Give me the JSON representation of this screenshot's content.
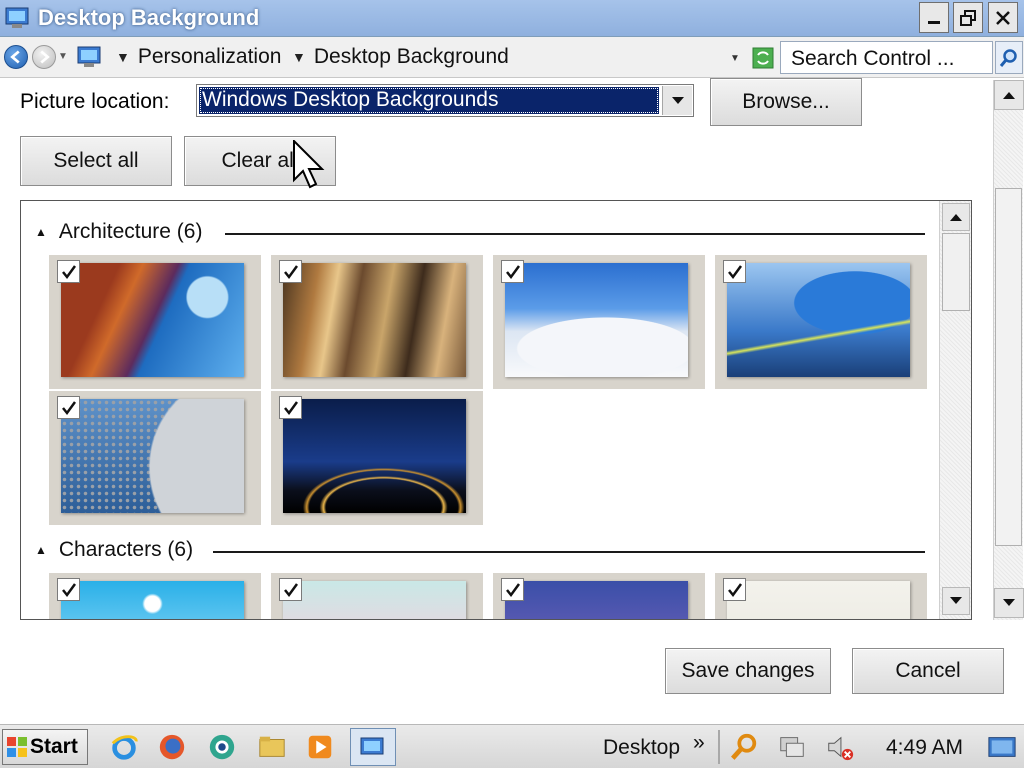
{
  "window": {
    "title": "Desktop Background"
  },
  "addressbar": {
    "breadcrumb": [
      "Personalization",
      "Desktop Background"
    ],
    "search_placeholder": "Search Control ..."
  },
  "location": {
    "label": "Picture location:",
    "selected": "Windows Desktop Backgrounds",
    "browse_label": "Browse..."
  },
  "actions": {
    "select_all": "Select all",
    "clear_all": "Clear all"
  },
  "groups": [
    {
      "name": "Architecture (6)",
      "items": [
        {
          "checked": true,
          "icon": "architecture-space-needle"
        },
        {
          "checked": true,
          "icon": "architecture-metal-curves"
        },
        {
          "checked": true,
          "icon": "architecture-white-building"
        },
        {
          "checked": true,
          "icon": "architecture-blue-curve"
        },
        {
          "checked": true,
          "icon": "architecture-disc-facade"
        },
        {
          "checked": true,
          "icon": "architecture-arch-tunnel"
        }
      ]
    },
    {
      "name": "Characters (6)",
      "items": [
        {
          "checked": true,
          "icon": "characters-castle"
        },
        {
          "checked": true,
          "icon": "characters-pastel"
        },
        {
          "checked": true,
          "icon": "characters-creatures"
        },
        {
          "checked": true,
          "icon": "characters-sketch"
        }
      ]
    }
  ],
  "footer": {
    "save_label": "Save changes",
    "cancel_label": "Cancel"
  },
  "taskbar": {
    "start_label": "Start",
    "desktop_label": "Desktop",
    "chevron": "»",
    "clock": "4:49 AM"
  }
}
